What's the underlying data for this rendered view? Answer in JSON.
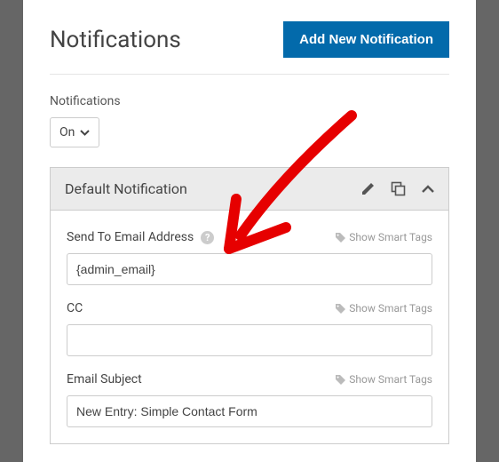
{
  "header": {
    "title": "Notifications",
    "add_button": "Add New Notification"
  },
  "toggle": {
    "label": "Notifications",
    "value": "On"
  },
  "card": {
    "title": "Default Notification",
    "fields": {
      "send_to": {
        "label": "Send To Email Address",
        "value": "{admin_email}",
        "smart_tags": "Show Smart Tags"
      },
      "cc": {
        "label": "CC",
        "value": "",
        "smart_tags": "Show Smart Tags"
      },
      "subject": {
        "label": "Email Subject",
        "value": "New Entry: Simple Contact Form",
        "smart_tags": "Show Smart Tags"
      }
    }
  },
  "icons": {
    "help": "?"
  }
}
